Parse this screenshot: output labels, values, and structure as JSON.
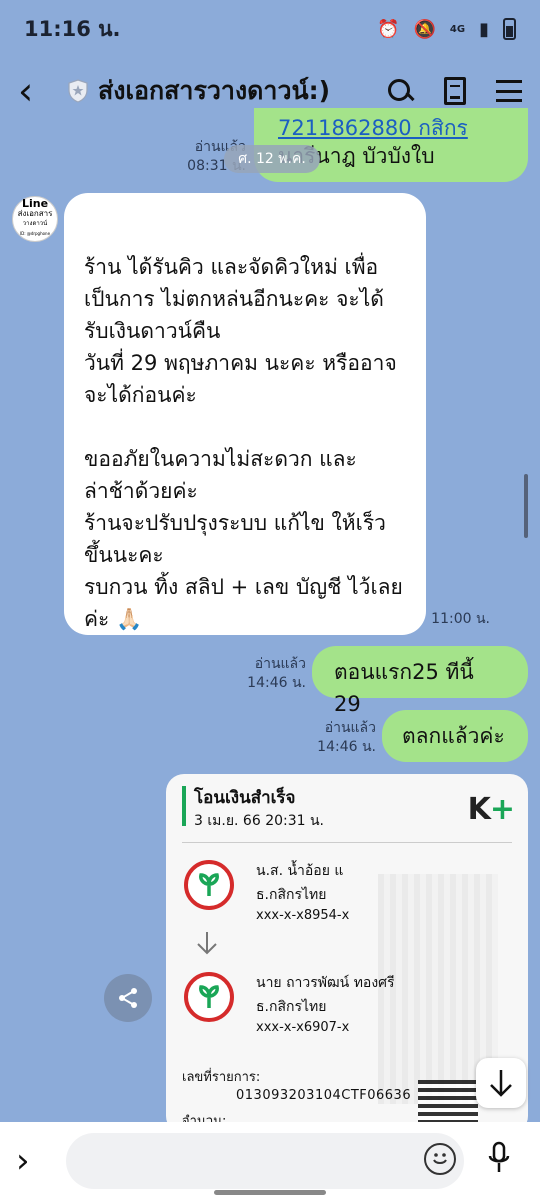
{
  "status_bar": {
    "time": "11:16 น.",
    "network": "4G"
  },
  "header": {
    "title": "ส่งเอกสารวางดาวน์:)"
  },
  "messages": {
    "top_partial": {
      "read": "อ่านแล้ว",
      "time": "08:31 น.",
      "line1": "7211862880 กสิกรไทย",
      "line2": "นารีนาฎ บัวบังใบ"
    },
    "date_chip": "ศ. 12 พ.ค.",
    "shop_message": {
      "avatar_line1": "Line",
      "avatar_line2": "ส่งเอกสาร",
      "avatar_line3": "วางดาวน์",
      "avatar_line4": "ID: @drpghone",
      "text": "ร้าน ได้รันคิว และจัดคิวใหม่ เพื่อ\nเป็นการ ไม่ตกหล่นอีกนะคะ จะได้\nรับเงินดาวน์คืน\nวันที่ 29 พฤษภาคม นะคะ หรืออาจ\nจะได้ก่อนค่ะ\n\nขออภัยในความไม่สะดวก และ\nล่าช้าด้วยค่ะ\nร้านจะปรับปรุงระบบ แก้ไข ให้เร็ว\nขึ้นนะคะ\nรบกวน ทิ้ง สลิป + เลข บัญชี ไว้เลย\nค่ะ 🙏🏻",
      "time": "11:00 น."
    },
    "reply1": {
      "read": "อ่านแล้ว",
      "time": "14:46 น.",
      "text": "ตอนแรก25 ทีนี้ 29"
    },
    "reply2": {
      "read": "อ่านแล้ว",
      "time": "14:46 น.",
      "text": "ตลกแล้วค่ะ"
    }
  },
  "slip": {
    "title": "โอนเงินสำเร็จ",
    "datetime": "3 เม.ย. 66  20:31 น.",
    "brand_k": "K",
    "brand_plus": "+",
    "from_name": "น.ส. น้ำอ้อย แ",
    "from_bank": "ธ.กสิกรไทย",
    "from_account": "xxx-x-x8954-x",
    "to_name": "นาย ถาวรพัฒน์ ทองศรี",
    "to_bank": "ธ.กสิกรไทย",
    "to_account": "xxx-x-x6907-x",
    "ref_label": "เลขที่รายการ:",
    "ref_number": "013093203104CTF06636",
    "amount_label": "จำนวน:"
  },
  "input": {
    "placeholder": ""
  }
}
